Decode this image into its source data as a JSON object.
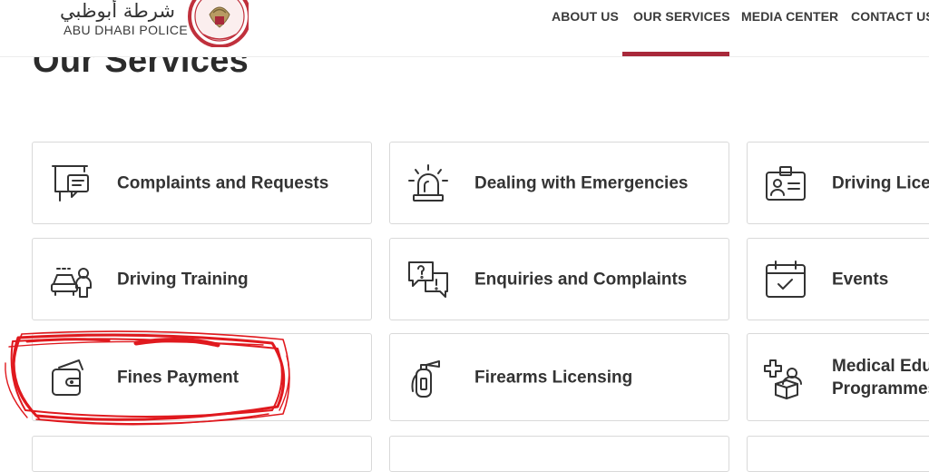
{
  "header": {
    "logo_arabic": "شرطة أبوظبي",
    "logo_english": "ABU DHABI POLICE",
    "nav": [
      {
        "label": "ABOUT US"
      },
      {
        "label": "OUR SERVICES",
        "active": true
      },
      {
        "label": "MEDIA CENTER"
      },
      {
        "label": "CONTACT US"
      }
    ],
    "accent_color": "#a8283a"
  },
  "page": {
    "title": "Our Services"
  },
  "services": [
    {
      "label": "Complaints and Requests",
      "icon": "presentation-board-icon"
    },
    {
      "label": "Dealing with Emergencies",
      "icon": "siren-icon"
    },
    {
      "label": "Driving Licen",
      "icon": "id-card-icon"
    },
    {
      "label": "Driving Training",
      "icon": "car-driver-icon"
    },
    {
      "label": "Enquiries and Complaints",
      "icon": "question-chat-icon"
    },
    {
      "label": "Events",
      "icon": "calendar-check-icon"
    },
    {
      "label": "Fines Payment",
      "icon": "wallet-icon"
    },
    {
      "label": "Firearms Licensing",
      "icon": "fire-extinguisher-icon"
    },
    {
      "label": "Medical Edu\nProgrammes",
      "icon": "medical-box-icon"
    }
  ],
  "annotation_color": "#e0191e"
}
